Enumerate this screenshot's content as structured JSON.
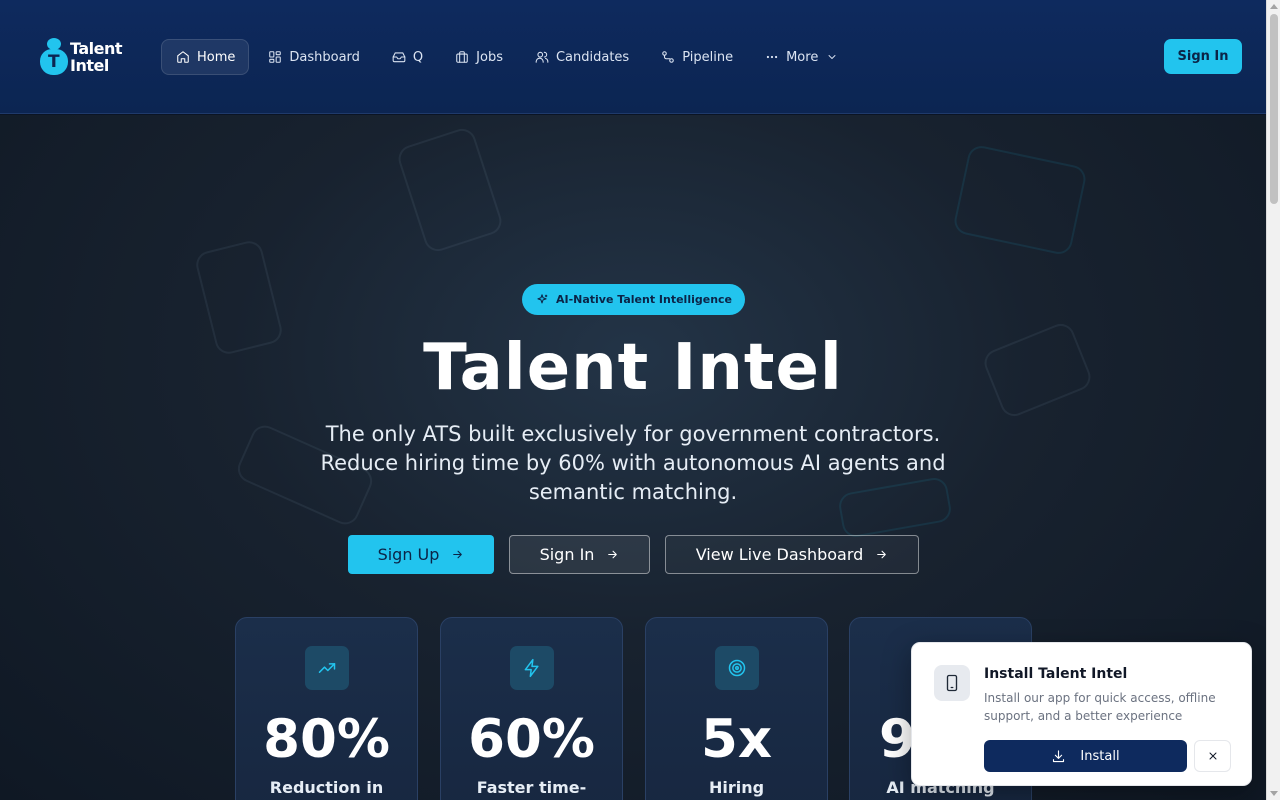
{
  "brand": {
    "name_line1": "Talent",
    "name_line2": "Intel",
    "mark_letter": "T",
    "accent": "#22c4ee",
    "navy": "#0e2a5e"
  },
  "nav": {
    "items": [
      {
        "label": "Home",
        "icon": "home-icon",
        "active": true
      },
      {
        "label": "Dashboard",
        "icon": "dashboard-grid-icon"
      },
      {
        "label": "Q",
        "icon": "inbox-icon"
      },
      {
        "label": "Jobs",
        "icon": "briefcase-icon"
      },
      {
        "label": "Candidates",
        "icon": "users-icon"
      },
      {
        "label": "Pipeline",
        "icon": "pipeline-icon"
      },
      {
        "label": "More",
        "icon": "ellipsis-icon"
      }
    ],
    "sign_in": "Sign In"
  },
  "hero": {
    "badge": "AI-Native Talent Intelligence",
    "title": "Talent Intel",
    "subtitle": "The only ATS built exclusively for government contractors. Reduce hiring time by 60% with autonomous AI agents and semantic matching.",
    "buttons": {
      "sign_up": "Sign Up",
      "sign_in": "Sign In",
      "dashboard": "View Live Dashboard"
    }
  },
  "stats": [
    {
      "value": "80%",
      "label": "Reduction in",
      "icon": "trending-up-icon"
    },
    {
      "value": "60%",
      "label": "Faster time-",
      "icon": "lightning-icon"
    },
    {
      "value": "5x",
      "label": "Hiring",
      "icon": "target-icon"
    },
    {
      "value": "9",
      "label": "AI matching",
      "icon": ""
    }
  ],
  "install_prompt": {
    "title": "Install Talent Intel",
    "description": "Install our app for quick access, offline support, and a better experience",
    "install_label": "Install",
    "icon": "smartphone-icon"
  }
}
